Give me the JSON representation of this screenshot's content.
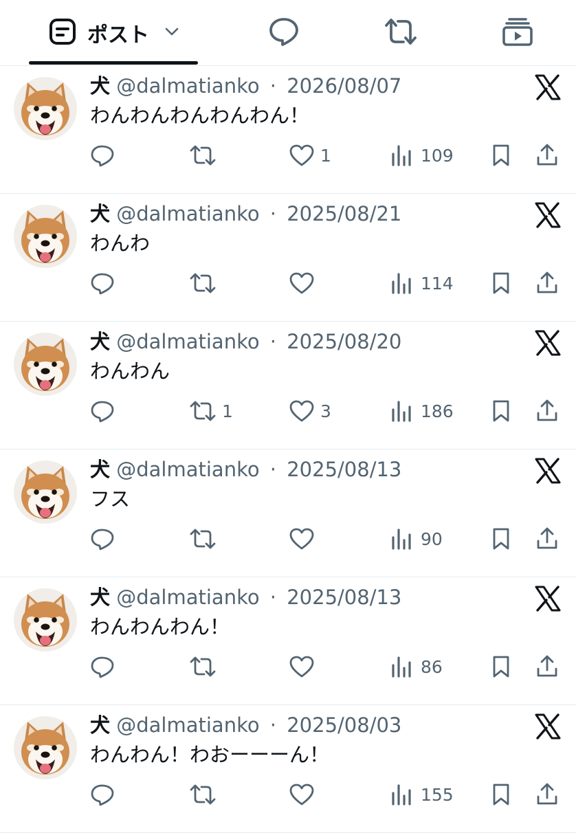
{
  "tabs": {
    "posts_label": "ポスト"
  },
  "posts": [
    {
      "name": "犬",
      "handle": "@dalmatianko",
      "sep": "·",
      "date": "2026/08/07",
      "text": "わんわんわんわんわん！",
      "reposts": "",
      "likes": "1",
      "views": "109"
    },
    {
      "name": "犬",
      "handle": "@dalmatianko",
      "sep": "·",
      "date": "2025/08/21",
      "text": "わんわ",
      "reposts": "",
      "likes": "",
      "views": "114"
    },
    {
      "name": "犬",
      "handle": "@dalmatianko",
      "sep": "·",
      "date": "2025/08/20",
      "text": "わんわん",
      "reposts": "1",
      "likes": "3",
      "views": "186"
    },
    {
      "name": "犬",
      "handle": "@dalmatianko",
      "sep": "·",
      "date": "2025/08/13",
      "text": "フス",
      "reposts": "",
      "likes": "",
      "views": "90"
    },
    {
      "name": "犬",
      "handle": "@dalmatianko",
      "sep": "·",
      "date": "2025/08/13",
      "text": "わんわんわん！",
      "reposts": "",
      "likes": "",
      "views": "86"
    },
    {
      "name": "犬",
      "handle": "@dalmatianko",
      "sep": "·",
      "date": "2025/08/03",
      "text": "わんわん！わおーーーん！",
      "reposts": "",
      "likes": "",
      "views": "155"
    }
  ],
  "icons": {
    "tab_posts": "list-box-icon",
    "tab_dropdown": "chevron-down-icon",
    "tab_replies": "speech-bubble-icon",
    "tab_reposts": "repost-icon",
    "tab_media": "video-stack-icon",
    "reply": "reply-icon",
    "repost": "repost-icon",
    "like": "heart-icon",
    "views": "views-bar-chart-icon",
    "bookmark": "bookmark-icon",
    "share": "share-icon",
    "source": "x-logo-icon",
    "avatar": "shiba-inu-avatar"
  },
  "colors": {
    "text_primary": "#0f1419",
    "text_secondary": "#536471",
    "divider": "#e6e9ec",
    "background": "#ffffff"
  }
}
